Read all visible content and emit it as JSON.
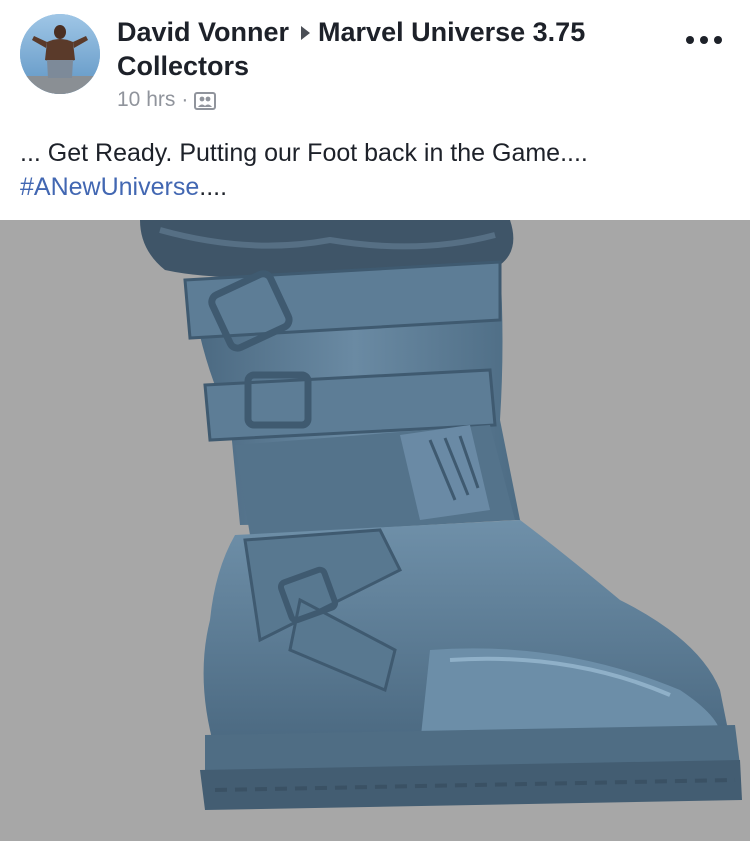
{
  "post": {
    "author": "David Vonner",
    "group": "Marvel Universe 3.75 Collectors",
    "time": "10 hrs",
    "separator": "·",
    "audience_icon": "group-audience-icon",
    "more_icon": "more-options-icon",
    "text_before": "... Get Ready. Putting our Foot back in the Game....",
    "hashtag": "#ANewUniverse",
    "text_after": "....",
    "photo_icon": "boot-sculpt-render"
  },
  "colors": {
    "text": "#1d2129",
    "meta": "#90949c",
    "link": "#4267b2",
    "photo_background": "#a7a7a7",
    "boot": "#5b7a92"
  }
}
